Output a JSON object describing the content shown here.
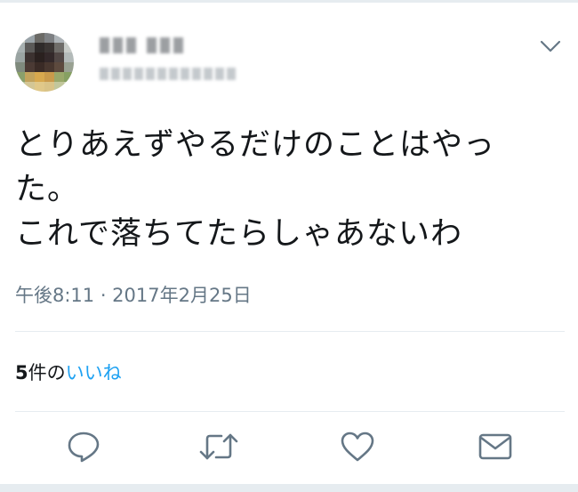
{
  "tweet": {
    "text": "とりあえずやるだけのことはやっ\nた。\nこれで落ちてたらしゃあないわ",
    "timestamp": "午後8:11 · 2017年2月25日"
  },
  "likes": {
    "count": "5",
    "counter": "件の",
    "link_label": "いいね"
  },
  "icons": {
    "caret": "chevron-down-icon",
    "reply": "reply-icon",
    "retweet": "retweet-icon",
    "like": "heart-icon",
    "dm": "envelope-icon"
  },
  "colors": {
    "text": "#14171a",
    "secondary": "#657786",
    "link": "#1da1f2",
    "border": "#e6ecf0"
  }
}
